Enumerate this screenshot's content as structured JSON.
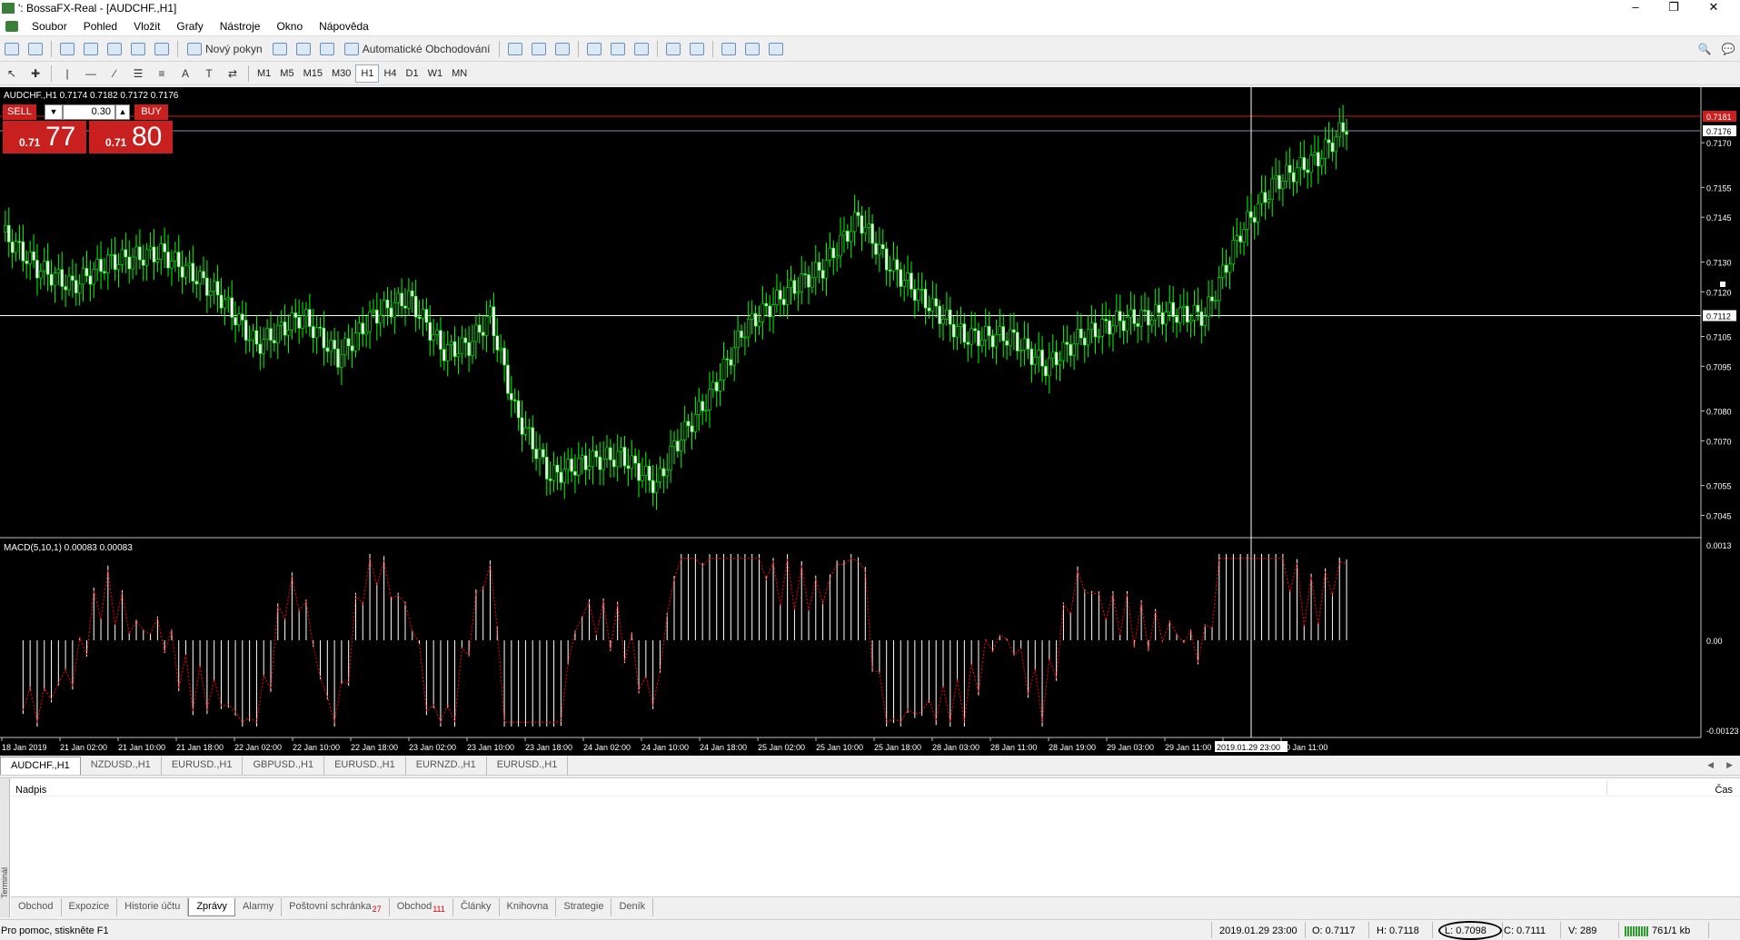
{
  "window": {
    "title": "': BossaFX-Real - [AUDCHF.,H1]",
    "controls": [
      "–",
      "❐",
      "✕"
    ]
  },
  "menu": [
    "Soubor",
    "Pohled",
    "Vložit",
    "Grafy",
    "Nástroje",
    "Okno",
    "Nápověda"
  ],
  "toolbar": {
    "new_order": "Nový pokyn",
    "auto_trading": "Automatické Obchodování",
    "timeframes": [
      "M1",
      "M5",
      "M15",
      "M30",
      "H1",
      "H4",
      "D1",
      "W1",
      "MN"
    ],
    "active_timeframe": "H1"
  },
  "chart": {
    "symbol_info": "AUDCHF.,H1  0.7174 0.7182 0.7172 0.7176",
    "trade_panel": {
      "sell": "SELL",
      "buy": "BUY",
      "lot": "0.30",
      "bid_small": "0.71",
      "bid_big": "77",
      "ask_small": "0.71",
      "ask_big": "80"
    },
    "price_axis": [
      "0.7170",
      "0.7155",
      "0.7145",
      "0.7130",
      "0.7120",
      "0.7105",
      "0.7095",
      "0.7080",
      "0.7070",
      "0.7055",
      "0.7045"
    ],
    "price_current": "0.7176",
    "price_crosshair": "0.7112",
    "price_ask": "0.7181",
    "macd_label": "MACD(5,10,1) 0.00083 0.00083",
    "macd_axis": [
      "0.0013",
      "0.00",
      "-0.00123"
    ],
    "time_axis": [
      "18 Jan 2019",
      "21 Jan 02:00",
      "21 Jan 10:00",
      "21 Jan 18:00",
      "22 Jan 02:00",
      "22 Jan 10:00",
      "22 Jan 18:00",
      "23 Jan 02:00",
      "23 Jan 10:00",
      "23 Jan 18:00",
      "24 Jan 02:00",
      "24 Jan 10:00",
      "24 Jan 18:00",
      "25 Jan 02:00",
      "25 Jan 10:00",
      "25 Jan 18:00",
      "28 Jan 03:00",
      "28 Jan 11:00",
      "28 Jan 19:00",
      "29 Jan 03:00",
      "29 Jan 11:00",
      "Jan 03:00",
      "30 Jan 11:00"
    ],
    "crosshair_time": "2019.01.29 23:00"
  },
  "chart_tabs": [
    "AUDCHF.,H1",
    "NZDUSD.,H1",
    "EURUSD.,H1",
    "GBPUSD.,H1",
    "EURUSD.,H1",
    "EURNZD.,H1",
    "EURUSD.,H1"
  ],
  "terminal": {
    "side_label": "Terminál",
    "col_title": "Nadpis",
    "col_time": "Čas",
    "tabs": [
      {
        "label": "Obchod",
        "count": ""
      },
      {
        "label": "Expozice",
        "count": ""
      },
      {
        "label": "Historie účtu",
        "count": ""
      },
      {
        "label": "Zprávy",
        "count": ""
      },
      {
        "label": "Alarmy",
        "count": ""
      },
      {
        "label": "Poštovní schránka",
        "count": "27"
      },
      {
        "label": "Obchod",
        "count": "111"
      },
      {
        "label": "Články",
        "count": ""
      },
      {
        "label": "Knihovna",
        "count": ""
      },
      {
        "label": "Strategie",
        "count": ""
      },
      {
        "label": "Deník",
        "count": ""
      }
    ],
    "active_tab": "Zprávy"
  },
  "status": {
    "help": "Pro pomoc, stiskněte F1",
    "datetime": "2019.01.29 23:00",
    "open": "O: 0.7117",
    "high": "H: 0.7118",
    "low": "L: 0.7098",
    "close": "C: 0.7111",
    "volume": "V: 289",
    "traffic": "761/1 kb"
  },
  "colors": {
    "chart_bg": "#000000",
    "candle": "#00ff00",
    "sell_buy": "#c81f1f",
    "macd_signal": "#ff0000"
  }
}
